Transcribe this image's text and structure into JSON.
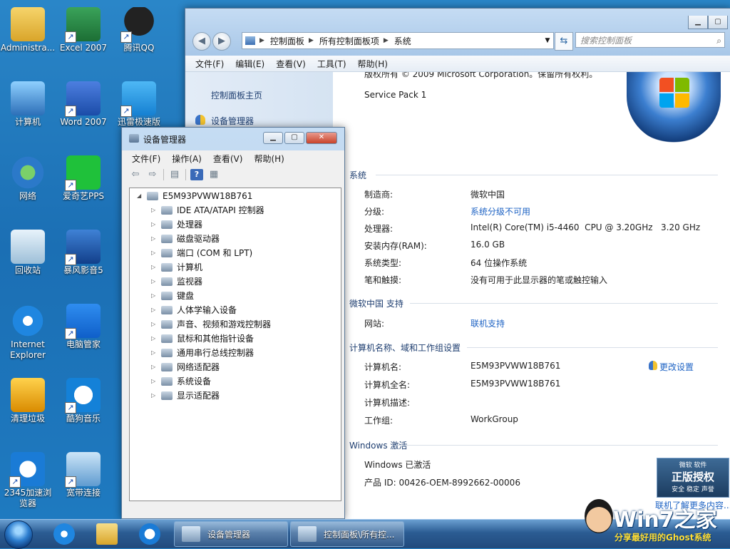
{
  "desktop": {
    "icons": [
      {
        "label": "Administra..."
      },
      {
        "label": "Excel 2007"
      },
      {
        "label": "腾讯QQ"
      },
      {
        "label": "计算机"
      },
      {
        "label": "Word 2007"
      },
      {
        "label": "迅雷极速版"
      },
      {
        "label": "网络"
      },
      {
        "label": "爱奇艺PPS"
      },
      {
        "label": "回收站"
      },
      {
        "label": "暴风影音5"
      },
      {
        "label": "Internet Explorer"
      },
      {
        "label": "电脑管家"
      },
      {
        "label": "清理垃圾"
      },
      {
        "label": "酷狗音乐"
      },
      {
        "label": "2345加速浏览器"
      },
      {
        "label": "宽带连接"
      }
    ]
  },
  "control_panel": {
    "address": {
      "crumbs": [
        "控制面板",
        "所有控制面板项",
        "系统"
      ]
    },
    "search_placeholder": "搜索控制面板",
    "menu": [
      "文件(F)",
      "编辑(E)",
      "查看(V)",
      "工具(T)",
      "帮助(H)"
    ],
    "left_links": {
      "home": "控制面板主页",
      "device_manager": "设备管理器"
    },
    "copyright_partial": "版权所有 © 2009 Microsoft Corporation。保留所有权利。",
    "service_pack": "Service Pack 1",
    "sections": {
      "system": {
        "title": "系统",
        "rows": [
          {
            "label": "制造商:",
            "value": "微软中国"
          },
          {
            "label": "分级:",
            "value": "系统分级不可用"
          },
          {
            "label": "处理器:",
            "value": "Intel(R) Core(TM) i5-4460  CPU @ 3.20GHz   3.20 GHz"
          },
          {
            "label": "安装内存(RAM):",
            "value": "16.0 GB"
          },
          {
            "label": "系统类型:",
            "value": "64 位操作系统"
          },
          {
            "label": "笔和触摸:",
            "value": "没有可用于此显示器的笔或触控输入"
          }
        ]
      },
      "support": {
        "title": "微软中国 支持",
        "rows": [
          {
            "label": "网站:",
            "value": "联机支持"
          }
        ]
      },
      "computer_name": {
        "title": "计算机名称、域和工作组设置",
        "change_link": "更改设置",
        "rows": [
          {
            "label": "计算机名:",
            "value": "E5M93PVWW18B761"
          },
          {
            "label": "计算机全名:",
            "value": "E5M93PVWW18B761"
          },
          {
            "label": "计算机描述:",
            "value": ""
          },
          {
            "label": "工作组:",
            "value": "WorkGroup"
          }
        ]
      },
      "activation": {
        "title": "Windows 激活",
        "status": "Windows 已激活",
        "product_id": "产品 ID: 00426-OEM-8992662-00006",
        "badge_top": "微软 软件",
        "badge_main": "正版授权",
        "badge_sub": "安全 稳定 声誉",
        "learn_more": "联机了解更多内容..."
      }
    }
  },
  "device_manager": {
    "title": "设备管理器",
    "menu": [
      "文件(F)",
      "操作(A)",
      "查看(V)",
      "帮助(H)"
    ],
    "root": "E5M93PVWW18B761",
    "nodes": [
      "IDE ATA/ATAPI 控制器",
      "处理器",
      "磁盘驱动器",
      "端口 (COM 和 LPT)",
      "计算机",
      "监视器",
      "键盘",
      "人体学输入设备",
      "声音、视频和游戏控制器",
      "鼠标和其他指针设备",
      "通用串行总线控制器",
      "网络适配器",
      "系统设备",
      "显示适配器"
    ]
  },
  "taskbar": {
    "tasks": [
      {
        "label": "设备管理器"
      },
      {
        "label": "控制面板\\所有控..."
      }
    ]
  },
  "brand": {
    "name": "Win7之家",
    "slogan": "分享最好用的Ghost系统"
  }
}
